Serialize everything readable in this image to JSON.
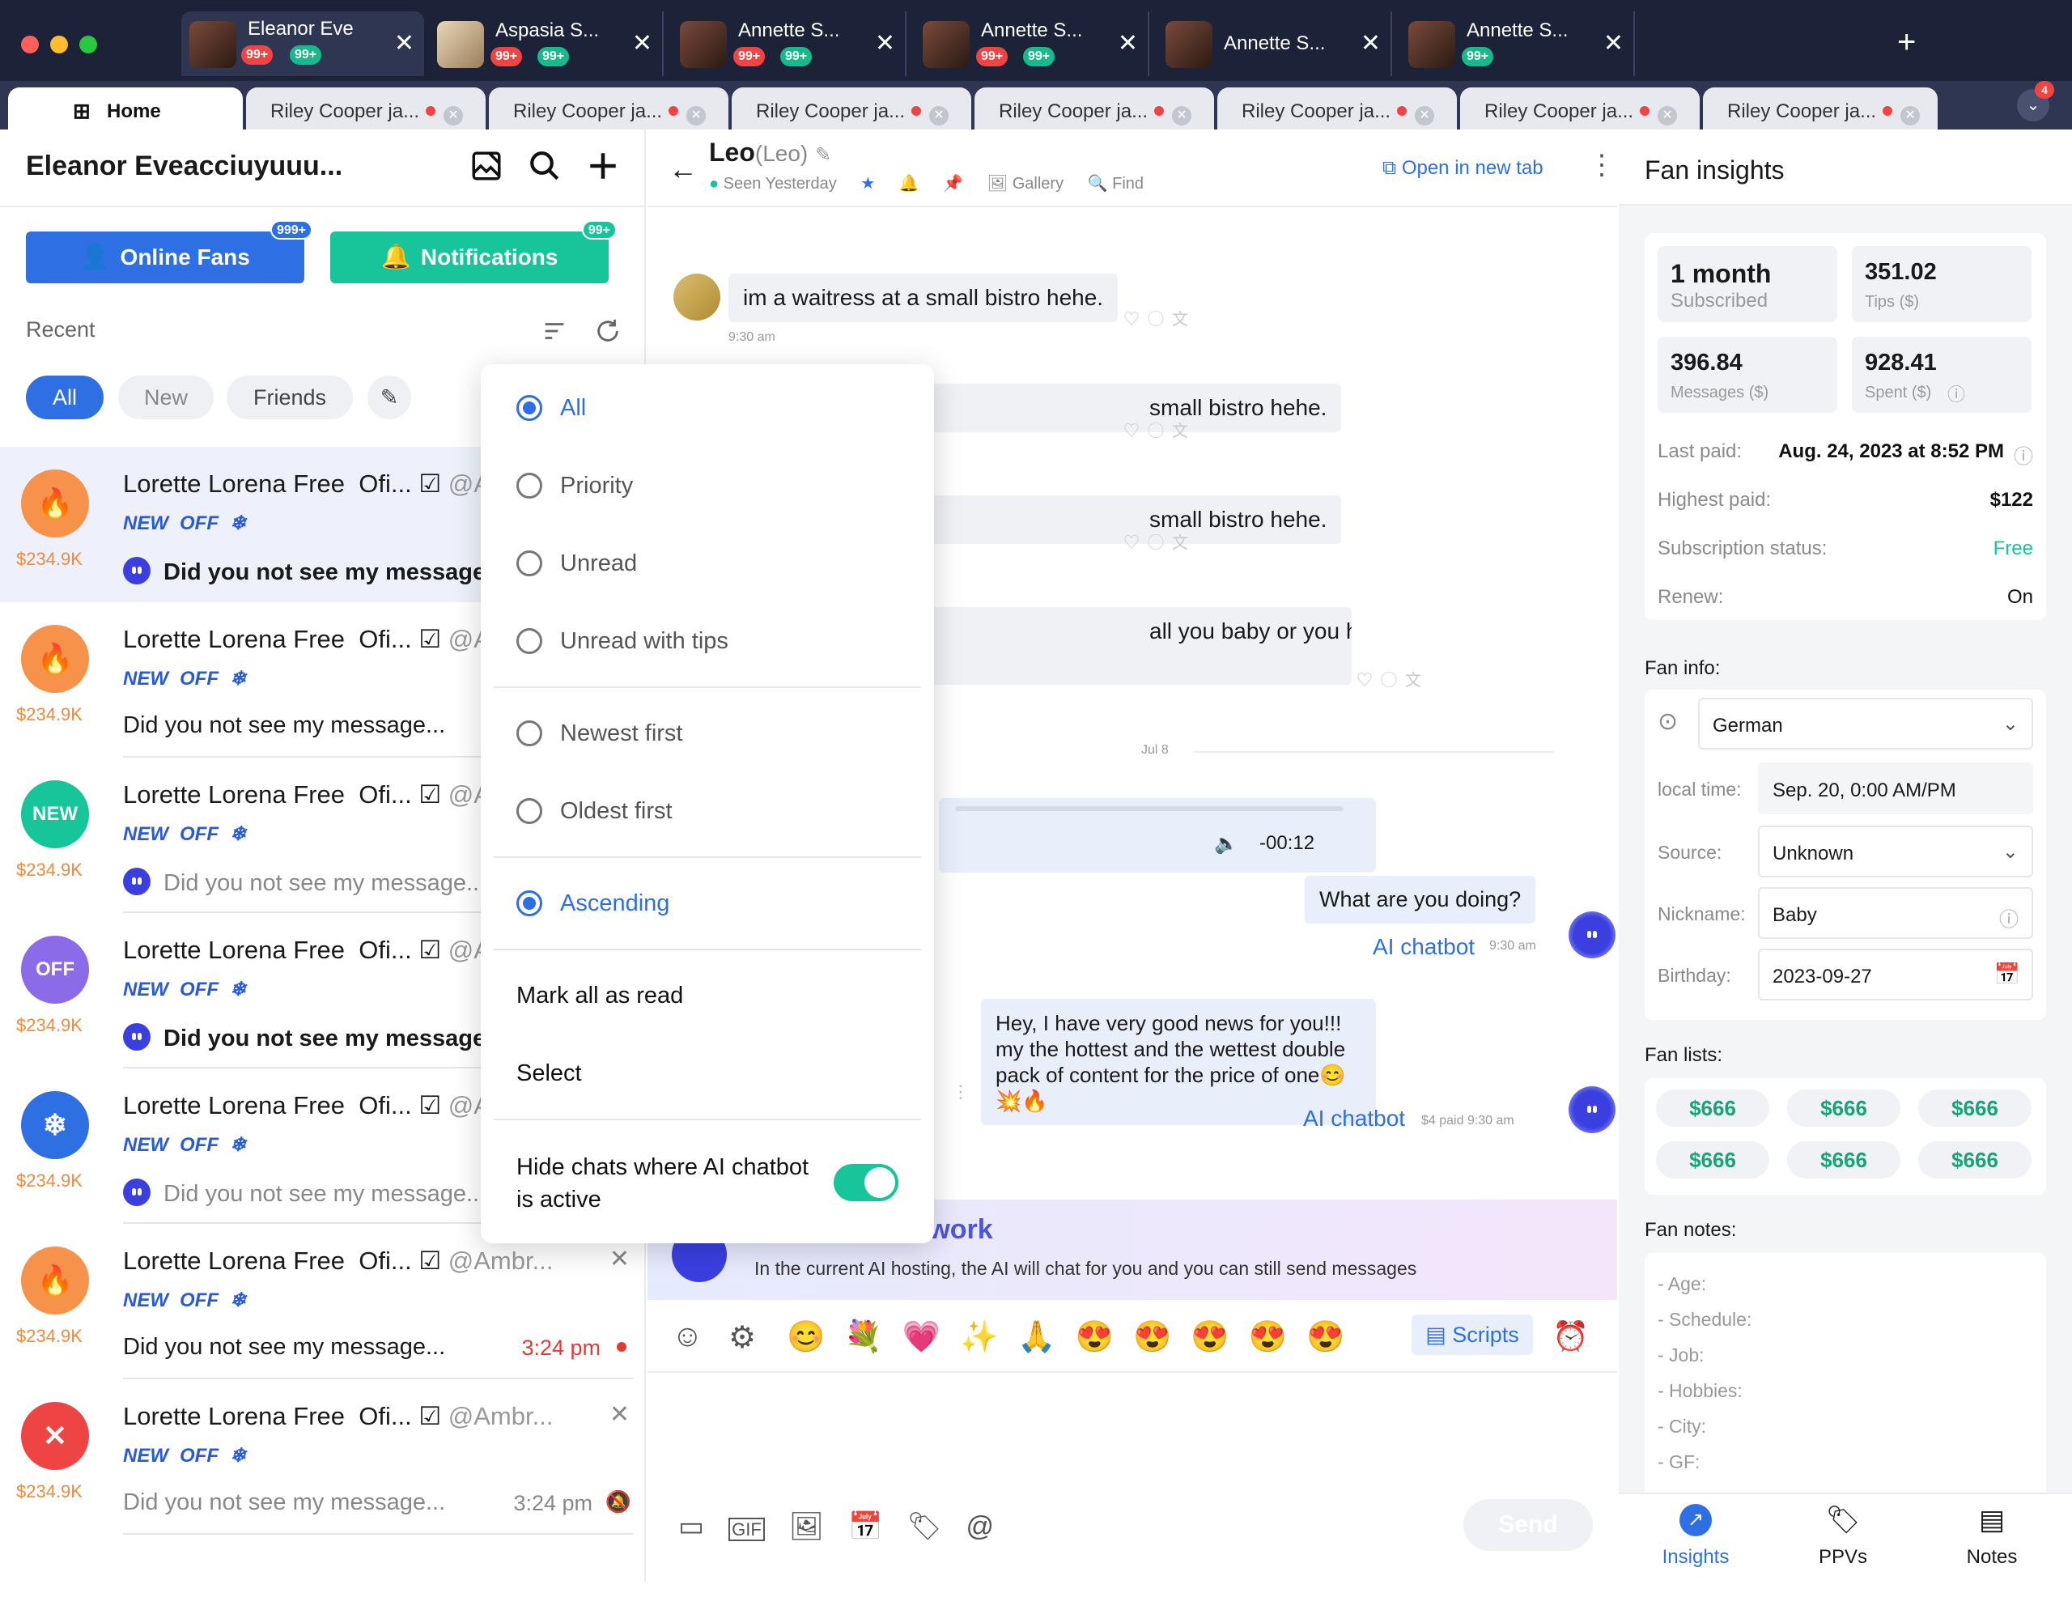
{
  "window_tabs": [
    {
      "name": "Eleanor Eve",
      "red": "99+",
      "green": "99+"
    },
    {
      "name": "Aspasia S...",
      "red": "99+",
      "green": "99+"
    },
    {
      "name": "Annette S...",
      "red": "99+",
      "green": "99+"
    },
    {
      "name": "Annette S...",
      "red": "99+",
      "green": "99+"
    },
    {
      "name": "Annette S...",
      "red": "",
      "green": ""
    },
    {
      "name": "Annette S...",
      "red": "",
      "green": "99+"
    }
  ],
  "chat_tabs": {
    "home": "Home",
    "items": [
      "Riley Cooper ja...",
      "Riley Cooper ja...",
      "Riley Cooper ja...",
      "Riley Cooper ja...",
      "Riley Cooper ja...",
      "Riley Cooper ja...",
      "Riley Cooper ja..."
    ],
    "more_badge": "4"
  },
  "left": {
    "title": "Eleanor Eveacciuyuuu...",
    "online_fans": "Online Fans",
    "online_badge": "999+",
    "notifications": "Notifications",
    "notif_badge": "99+",
    "recent": "Recent",
    "filters": [
      "All",
      "New",
      "Friends"
    ],
    "rows": [
      {
        "name": "Lorette Lorena",
        "free": "Free",
        "ofi": "Ofi...",
        "handle": "@A",
        "price": "$234.9K",
        "msg": "Did you not see my message...",
        "avatar": "fire",
        "time": "",
        "ai": true
      },
      {
        "name": "Lorette Lorena",
        "free": "Free",
        "ofi": "Ofi...",
        "handle": "@A",
        "price": "$234.9K",
        "msg": "Did you not see my message...",
        "avatar": "fire",
        "time": "",
        "ai": false
      },
      {
        "name": "Lorette Lorena",
        "free": "Free",
        "ofi": "Ofi...",
        "handle": "@A",
        "price": "$234.9K",
        "msg": "Did you not see my message...",
        "avatar": "NEW",
        "time": "",
        "ai": true
      },
      {
        "name": "Lorette Lorena",
        "free": "Free",
        "ofi": "Ofi...",
        "handle": "@A",
        "price": "$234.9K",
        "msg": "Did you not see my message...",
        "avatar": "OFF",
        "time": "",
        "ai": true
      },
      {
        "name": "Lorette Lorena",
        "free": "Free",
        "ofi": "Ofi...",
        "handle": "@A",
        "price": "$234.9K",
        "msg": "Did you not see my message...",
        "avatar": "snow",
        "time": "",
        "ai": true
      },
      {
        "name": "Lorette Lorena",
        "free": "Free",
        "ofi": "Ofi...",
        "handle": "@Ambr...",
        "price": "$234.9K",
        "msg": "Did you not see my message...",
        "avatar": "fire",
        "time": "3:24 pm",
        "ai": false
      },
      {
        "name": "Lorette Lorena",
        "free": "Free",
        "ofi": "Ofi...",
        "handle": "@Ambr...",
        "price": "$234.9K",
        "msg": "Did you not see my message...",
        "avatar": "x",
        "time": "3:24 pm",
        "ai": false
      }
    ],
    "tag_new": "NEW",
    "tag_off": "OFF"
  },
  "dropdown": {
    "options": [
      "All",
      "Priority",
      "Unread",
      "Unread with tips",
      "Newest first",
      "Oldest first",
      "Ascending"
    ],
    "actions": [
      "Mark all as read",
      "Select"
    ],
    "toggle_label_1": "Hide chats where AI chatbot",
    "toggle_label_2": "is active"
  },
  "chat": {
    "name": "Leo",
    "alias": "(Leo)",
    "seen": "Seen Yesterday",
    "gallery": "Gallery",
    "find": "Find",
    "open_tab": "Open in new tab",
    "m1": "im a waitress at a small bistro hehe.",
    "m1_time": "9:30 am",
    "m2": "small bistro hehe.",
    "m3": "small bistro hehe.",
    "m4": "all you baby or you have another name",
    "date_sep": "Jul 8",
    "audio_time": "-00:12",
    "m5": "What are you doing?",
    "ai_label": "AI chatbot",
    "m5_time": "9:30 am",
    "m6": "Hey, I have very good news for you!!! my the hottest and the wettest double pack of content for the price of one😊 💥🔥",
    "m6_meta": "$4 paid 9:30 am",
    "ai_banner_title": "AI chatbot at work",
    "ai_banner_text": "In the current AI hosting, the AI will chat for you and you can still send messages",
    "scripts": "Scripts",
    "send": "Send",
    "emojis": [
      "😊",
      "💐",
      "💗",
      "✨",
      "🙏",
      "😍",
      "😍",
      "😍",
      "😍",
      "😍"
    ]
  },
  "insights": {
    "title": "Fan insights",
    "stats": [
      {
        "v": "1 month",
        "l": "Subscribed"
      },
      {
        "v": "351.02",
        "l": "Tips ($)"
      },
      {
        "v": "396.84",
        "l": "Messages ($)"
      },
      {
        "v": "928.41",
        "l": "Spent ($)"
      }
    ],
    "last_paid_k": "Last paid:",
    "last_paid_v": "Aug. 24, 2023 at 8:52 PM",
    "highest_k": "Highest paid:",
    "highest_v": "$122",
    "sub_k": "Subscription status:",
    "sub_v": "Free",
    "renew_k": "Renew:",
    "renew_v": "On",
    "fan_info": "Fan info:",
    "language": "German",
    "local_k": "local time:",
    "local_v": "Sep. 20, 0:00 AM/PM",
    "source_k": "Source:",
    "source_v": "Unknown",
    "nick_k": "Nickname:",
    "nick_v": "Baby",
    "bday_k": "Birthday:",
    "bday_v": "2023-09-27",
    "fan_lists": "Fan lists:",
    "lists": [
      "$666",
      "$666",
      "$666",
      "$666",
      "$666",
      "$666"
    ],
    "fan_notes": "Fan notes:",
    "notes": [
      "- Age:",
      "- Schedule:",
      "- Job:",
      "- Hobbies:",
      "- City:",
      "- GF:"
    ],
    "nav": [
      "Insights",
      "PPVs",
      "Notes"
    ]
  }
}
